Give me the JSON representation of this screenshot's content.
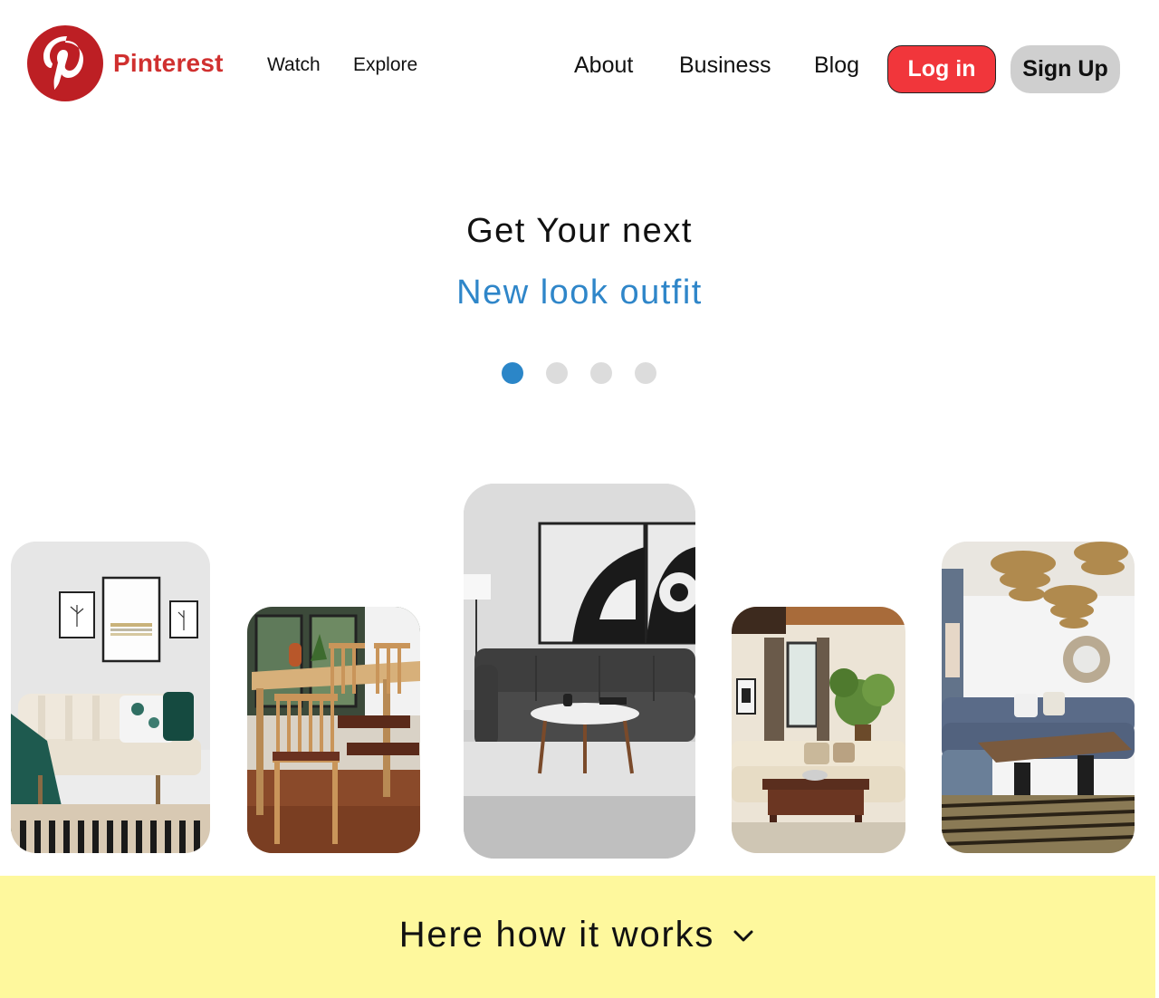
{
  "header": {
    "brand": "Pinterest",
    "logo_icon": "pinterest-logo-icon",
    "left_nav": [
      "Watch",
      "Explore"
    ],
    "right_nav": [
      "About",
      "Business",
      "Blog"
    ],
    "login_label": "Log in",
    "signup_label": "Sign Up"
  },
  "hero": {
    "title": "Get Your next",
    "subtitle": "New look outfit",
    "carousel_dots": 4,
    "active_dot": 0
  },
  "gallery": {
    "images": [
      "living-room-sofa-photo",
      "dining-table-chairs-photo",
      "grey-sectional-sofa-photo",
      "beige-living-room-photo",
      "blue-sectional-living-room-photo"
    ]
  },
  "footer": {
    "how_label": "Here how it works",
    "chevron_icon": "chevron-down-icon"
  },
  "colors": {
    "brand_red": "#d0302f",
    "login_red": "#f1363b",
    "accent_blue": "#2f86c9",
    "band_yellow": "#fef89d"
  }
}
